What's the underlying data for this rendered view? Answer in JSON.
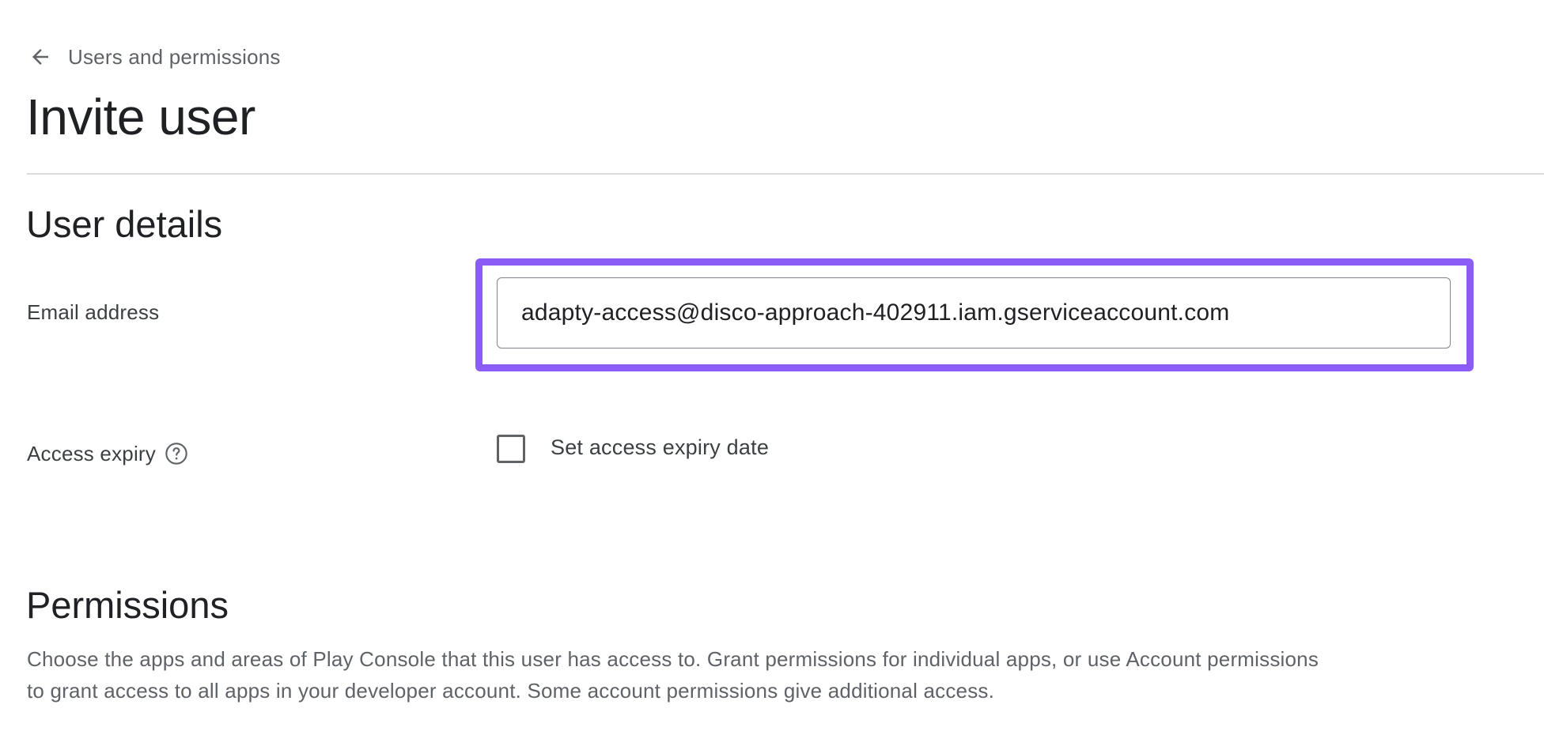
{
  "breadcrumb": {
    "icon": "arrow-back-icon",
    "label": "Users and permissions"
  },
  "page_title": "Invite user",
  "user_details": {
    "title": "User details",
    "email": {
      "label": "Email address",
      "value": "adapty-access@disco-approach-402911.iam.gserviceaccount.com"
    },
    "access_expiry": {
      "label": "Access expiry",
      "help_icon": "help-circle-icon",
      "checkbox_label": "Set access expiry date",
      "checked": false
    }
  },
  "permissions": {
    "title": "Permissions",
    "description_line1": "Choose the apps and areas of Play Console that this user has access to. Grant permissions for individual apps, or use Account permissions",
    "description_line2": "to grant access to all apps in your developer account. Some account permissions give additional access."
  },
  "colors": {
    "highlight": "#8b5cf6",
    "text_primary": "#202124",
    "text_secondary": "#5f6368",
    "divider": "#dadce0"
  }
}
